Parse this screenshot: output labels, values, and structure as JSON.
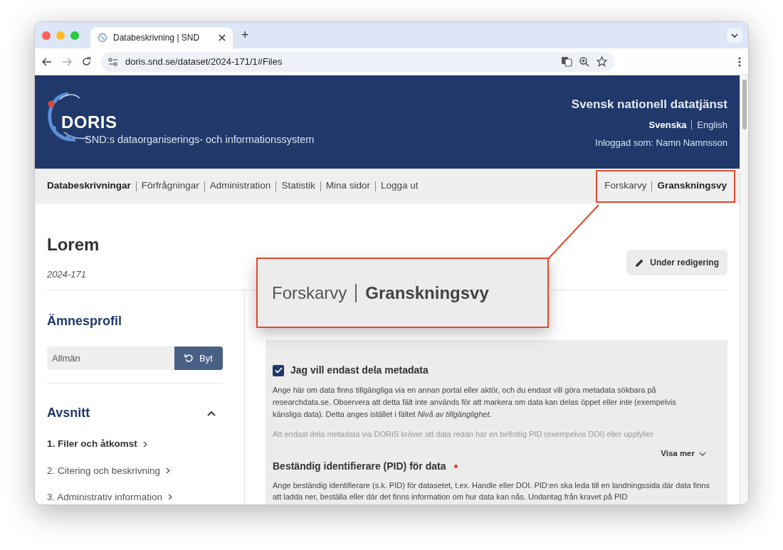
{
  "browser": {
    "tab_title": "Databeskrivning | SND",
    "new_tab": "+",
    "url": "doris.snd.se/dataset/2024-171/1#Files"
  },
  "header": {
    "logo": "DORIS",
    "subtitle": "SND:s dataorganiserings- och informationssystem",
    "org": "Svensk nationell datatjänst",
    "languages": [
      {
        "label": "Svenska",
        "selected": true
      },
      {
        "label": "English",
        "selected": false
      }
    ],
    "logged_in": "Inloggad som: Namn Namnsson"
  },
  "nav": {
    "items": [
      {
        "label": "Databeskrivningar",
        "selected": true
      },
      {
        "label": "Förfrågningar",
        "selected": false
      },
      {
        "label": "Administration",
        "selected": false
      },
      {
        "label": "Statistik",
        "selected": false
      },
      {
        "label": "Mina sidor",
        "selected": false
      },
      {
        "label": "Logga ut",
        "selected": false
      }
    ],
    "views": [
      {
        "label": "Forskarvy",
        "selected": false
      },
      {
        "label": "Granskningsvy",
        "selected": true
      }
    ]
  },
  "callout": {
    "views": [
      {
        "label": "Forskarvy",
        "selected": false
      },
      {
        "label": "Granskningsvy",
        "selected": true
      }
    ]
  },
  "dataset": {
    "title": "Lorem",
    "id": "2024-171",
    "status_button": "Under redigering"
  },
  "sidebar": {
    "profile_heading": "Ämnesprofil",
    "profile_value": "Allmän",
    "change_button": "Byt",
    "sections_heading": "Avsnitt",
    "expanded": true,
    "sections": [
      {
        "label": "1. Filer och åtkomst",
        "selected": true
      },
      {
        "label": "2. Citering och beskrivning",
        "selected": false
      },
      {
        "label": "3. Administrativ information",
        "selected": false
      }
    ]
  },
  "form": {
    "checkbox": {
      "label": "Jag vill endast dela metadata",
      "checked": true
    },
    "description": "Ange här om data finns tillgängliga via en annan portal eller aktör, och du endast vill göra metadata sökbara på researchdata.se. Observera att detta fält inte används för att markera om data kan delas öppet eller inte (exempelvis känsliga data). Detta anges istället i fältet *Nivå av tillgänglighet*.",
    "faded_text": "Att endast dela metadata via DORIS kräver att data redan har en befintlig PID (exempelvis DOI) eller uppfyller",
    "more_link": "Visa mer",
    "pid": {
      "heading": "Beständig identifierare (PID) för data",
      "required": true,
      "text": "Ange beständig identifierare (s.k. PID) för datasetet, t.ex. Handle eller DOI. PID:en ska leda till en landningssida där data finns att ladda ner, beställa eller där det finns information om hur data kan nås. Undantag från kravet på PID"
    }
  }
}
